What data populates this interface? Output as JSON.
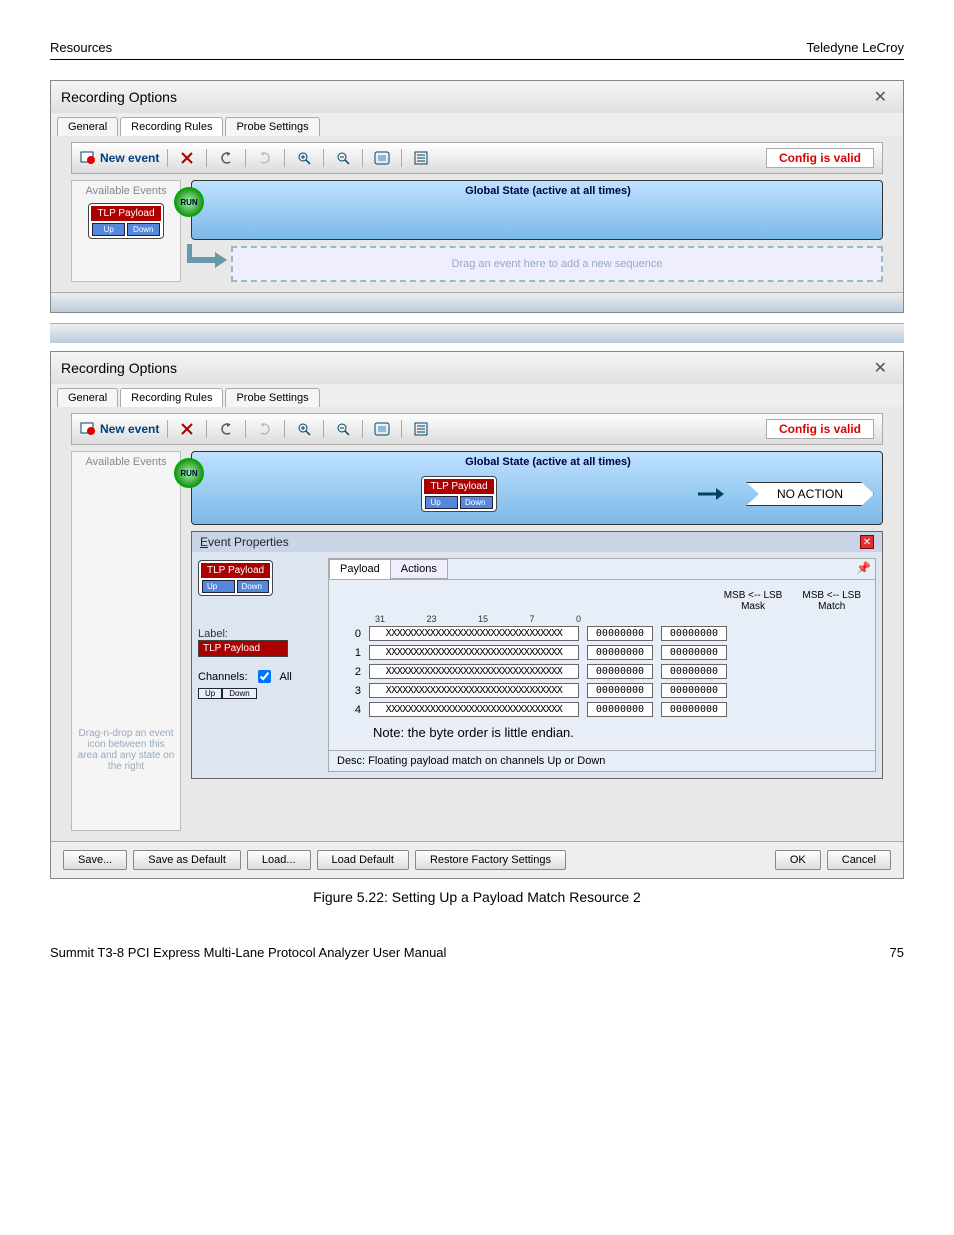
{
  "page": {
    "header_left": "Resources",
    "header_right": "Teledyne LeCroy",
    "footer_left": "Summit T3-8 PCI Express Multi-Lane Protocol Analyzer User Manual",
    "footer_right": "75",
    "caption": "Figure 5.22:  Setting Up a Payload Match Resource 2"
  },
  "dialog1": {
    "title": "Recording Options",
    "tabs": [
      "General",
      "Recording Rules",
      "Probe Settings"
    ],
    "active_tab": 1,
    "new_event": "New event",
    "config_valid": "Config is valid",
    "sidebar_title": "Available Events",
    "tlp_label": "TLP Payload",
    "tlp_up": "Up",
    "tlp_down": "Down",
    "state_label": "Global State (active at all times)",
    "run": "RUN",
    "drag_hint": "Drag an event here to add a new sequence"
  },
  "dialog2": {
    "title": "Recording Options",
    "tabs": [
      "General",
      "Recording Rules",
      "Probe Settings"
    ],
    "active_tab": 1,
    "new_event": "New event",
    "config_valid": "Config is valid",
    "sidebar_title": "Available Events",
    "state_label": "Global State (active at all times)",
    "run": "RUN",
    "no_action": "NO ACTION",
    "tlp_label": "TLP Payload",
    "tlp_up": "Up",
    "tlp_down": "Down",
    "hint": "Drag-n-drop an event icon between this area and any state on the right"
  },
  "event_props": {
    "title": "Event Properties",
    "tlp_label": "TLP Payload",
    "tlp_up": "Up",
    "tlp_down": "Down",
    "label_field_label": "Label:",
    "label_field_value": "TLP Payload",
    "channels_label": "Channels:",
    "channels_all": "All",
    "ch_up": "Up",
    "ch_down": "Down",
    "inner_tabs": [
      "Payload",
      "Actions"
    ],
    "active_inner_tab": 0,
    "msb_mask": "MSB <-- LSB",
    "mask_col": "Mask",
    "match_col": "Match",
    "bit_cols": [
      "31",
      "23",
      "15",
      "7",
      "0"
    ],
    "rows": [
      {
        "idx": "0",
        "bits": "XXXXXXXXXXXXXXXXXXXXXXXXXXXXXXXX",
        "mask": "00000000",
        "match": "00000000"
      },
      {
        "idx": "1",
        "bits": "XXXXXXXXXXXXXXXXXXXXXXXXXXXXXXXX",
        "mask": "00000000",
        "match": "00000000"
      },
      {
        "idx": "2",
        "bits": "XXXXXXXXXXXXXXXXXXXXXXXXXXXXXXXX",
        "mask": "00000000",
        "match": "00000000"
      },
      {
        "idx": "3",
        "bits": "XXXXXXXXXXXXXXXXXXXXXXXXXXXXXXXX",
        "mask": "00000000",
        "match": "00000000"
      },
      {
        "idx": "4",
        "bits": "XXXXXXXXXXXXXXXXXXXXXXXXXXXXXXXX",
        "mask": "00000000",
        "match": "00000000"
      }
    ],
    "note": "Note: the byte order is little endian.",
    "desc": "Desc: Floating payload match on channels Up or Down"
  },
  "footer_buttons": {
    "save": "Save...",
    "save_default": "Save as Default",
    "load": "Load...",
    "load_default": "Load Default",
    "restore": "Restore Factory Settings",
    "ok": "OK",
    "cancel": "Cancel"
  }
}
